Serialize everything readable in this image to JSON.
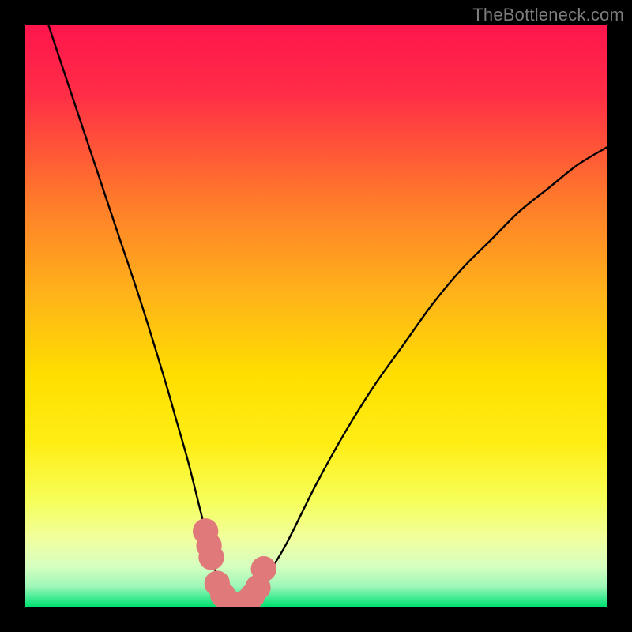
{
  "watermark": "TheBottleneck.com",
  "chart_data": {
    "type": "line",
    "title": "",
    "xlabel": "",
    "ylabel": "",
    "xlim": [
      0,
      100
    ],
    "ylim": [
      0,
      100
    ],
    "background_gradient": {
      "top": "#ff154d",
      "upper_mid": "#ff8a26",
      "mid": "#ffe600",
      "lower_mid": "#f3ff6e",
      "near_bottom": "#d2ffb3",
      "bottom": "#00e06e"
    },
    "series": [
      {
        "name": "curve-left",
        "type": "line",
        "color": "#000000",
        "x": [
          4,
          8,
          12,
          16,
          20,
          24,
          26,
          28,
          30,
          31,
          32,
          33,
          34,
          35,
          36
        ],
        "y": [
          100,
          88,
          76,
          64,
          52,
          39,
          32,
          25,
          17,
          13,
          9,
          5,
          2.5,
          1,
          0
        ]
      },
      {
        "name": "curve-right",
        "type": "line",
        "color": "#000000",
        "x": [
          36,
          38,
          40,
          42,
          45,
          50,
          55,
          60,
          65,
          70,
          75,
          80,
          85,
          90,
          95,
          100
        ],
        "y": [
          0,
          1,
          3,
          6,
          11,
          21,
          30,
          38,
          45,
          52,
          58,
          63,
          68,
          72,
          76,
          79
        ]
      },
      {
        "name": "highlight-dots",
        "type": "scatter",
        "color": "#e07a7a",
        "marker_radius": 2.2,
        "x": [
          31,
          31.6,
          32,
          33,
          34,
          35,
          36,
          37,
          38,
          39,
          40,
          41
        ],
        "y": [
          13,
          10.5,
          8.5,
          4,
          2,
          0.8,
          0,
          0,
          0.8,
          1.8,
          3.3,
          6.5
        ]
      }
    ]
  }
}
